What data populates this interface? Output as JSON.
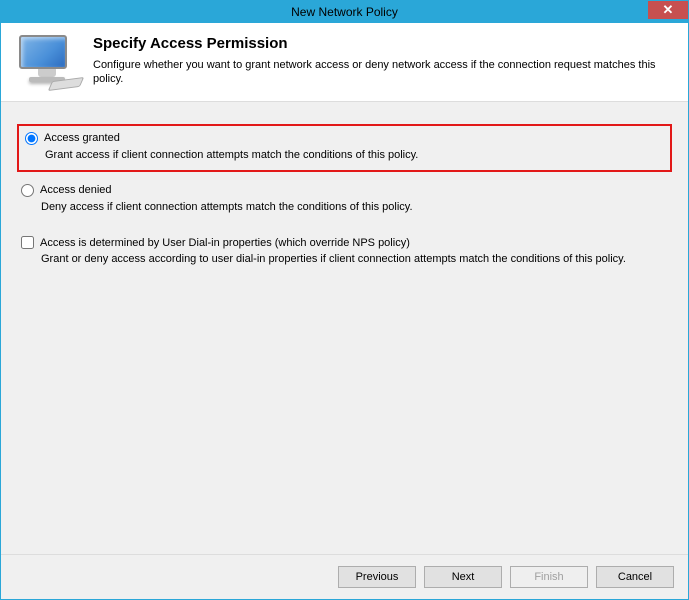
{
  "window": {
    "title": "New Network Policy"
  },
  "header": {
    "title": "Specify Access Permission",
    "subtitle": "Configure whether you want to grant network access or deny network access if the connection request matches this policy."
  },
  "options": {
    "granted": {
      "label": "Access granted",
      "desc": "Grant access if client connection attempts match the conditions of this policy.",
      "checked": true
    },
    "denied": {
      "label": "Access denied",
      "desc": "Deny access if client connection attempts match the conditions of this policy.",
      "checked": false
    },
    "dialin": {
      "label": "Access is determined by User Dial-in properties (which override NPS policy)",
      "desc": "Grant or deny access according to user dial-in properties if client connection attempts match the conditions of this policy.",
      "checked": false
    }
  },
  "buttons": {
    "previous": "Previous",
    "next": "Next",
    "finish": "Finish",
    "cancel": "Cancel"
  }
}
